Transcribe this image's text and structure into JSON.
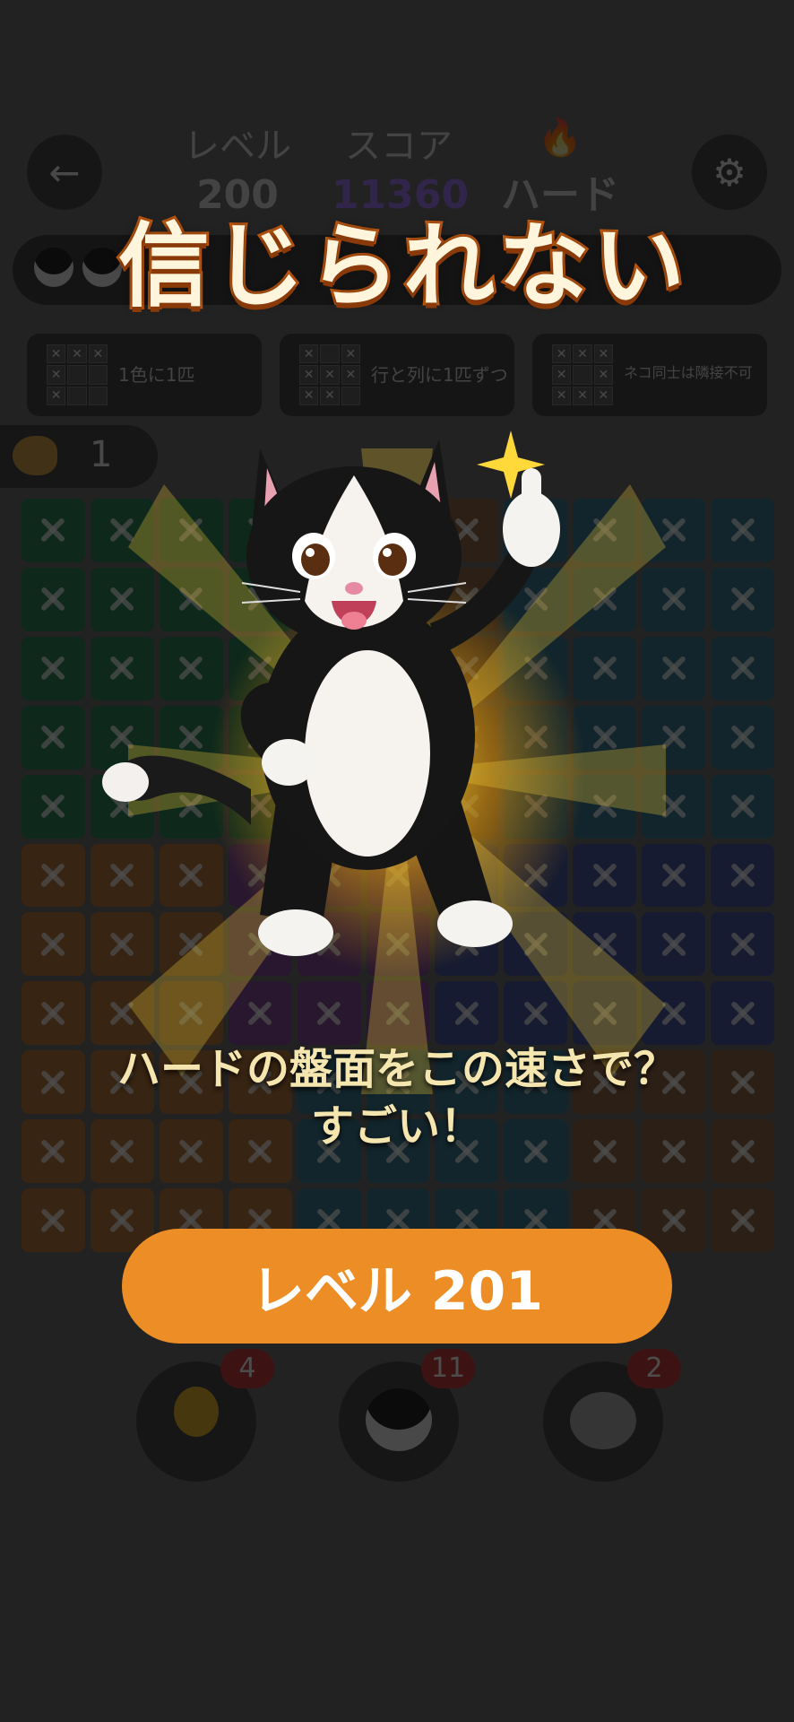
{
  "header": {
    "level_label": "レベル",
    "level_value": "200",
    "score_label": "スコア",
    "score_value": "11360",
    "difficulty_icon": "flame-icon",
    "difficulty_value": "ハード"
  },
  "rules": [
    {
      "text": "1色に1匹"
    },
    {
      "text": "行と列に1匹ずつ"
    },
    {
      "text": "ネコ同士は隣接不可"
    }
  ],
  "fish_count": "1",
  "tools": [
    {
      "icon": "lightbulb-icon",
      "badge": "4"
    },
    {
      "icon": "cat-face-icon",
      "badge": "11"
    },
    {
      "icon": "mouse-icon",
      "badge": "2"
    }
  ],
  "modal": {
    "title": "信じられない",
    "message_line1": "ハードの盤面をこの速さで？",
    "message_line2": "すごい！",
    "button_label": "レベル 201"
  },
  "colors": {
    "accent_orange": "#ec8e25",
    "title_fill": "#fff4dc",
    "title_stroke": "#c45a10",
    "glow": "#ffd228"
  }
}
